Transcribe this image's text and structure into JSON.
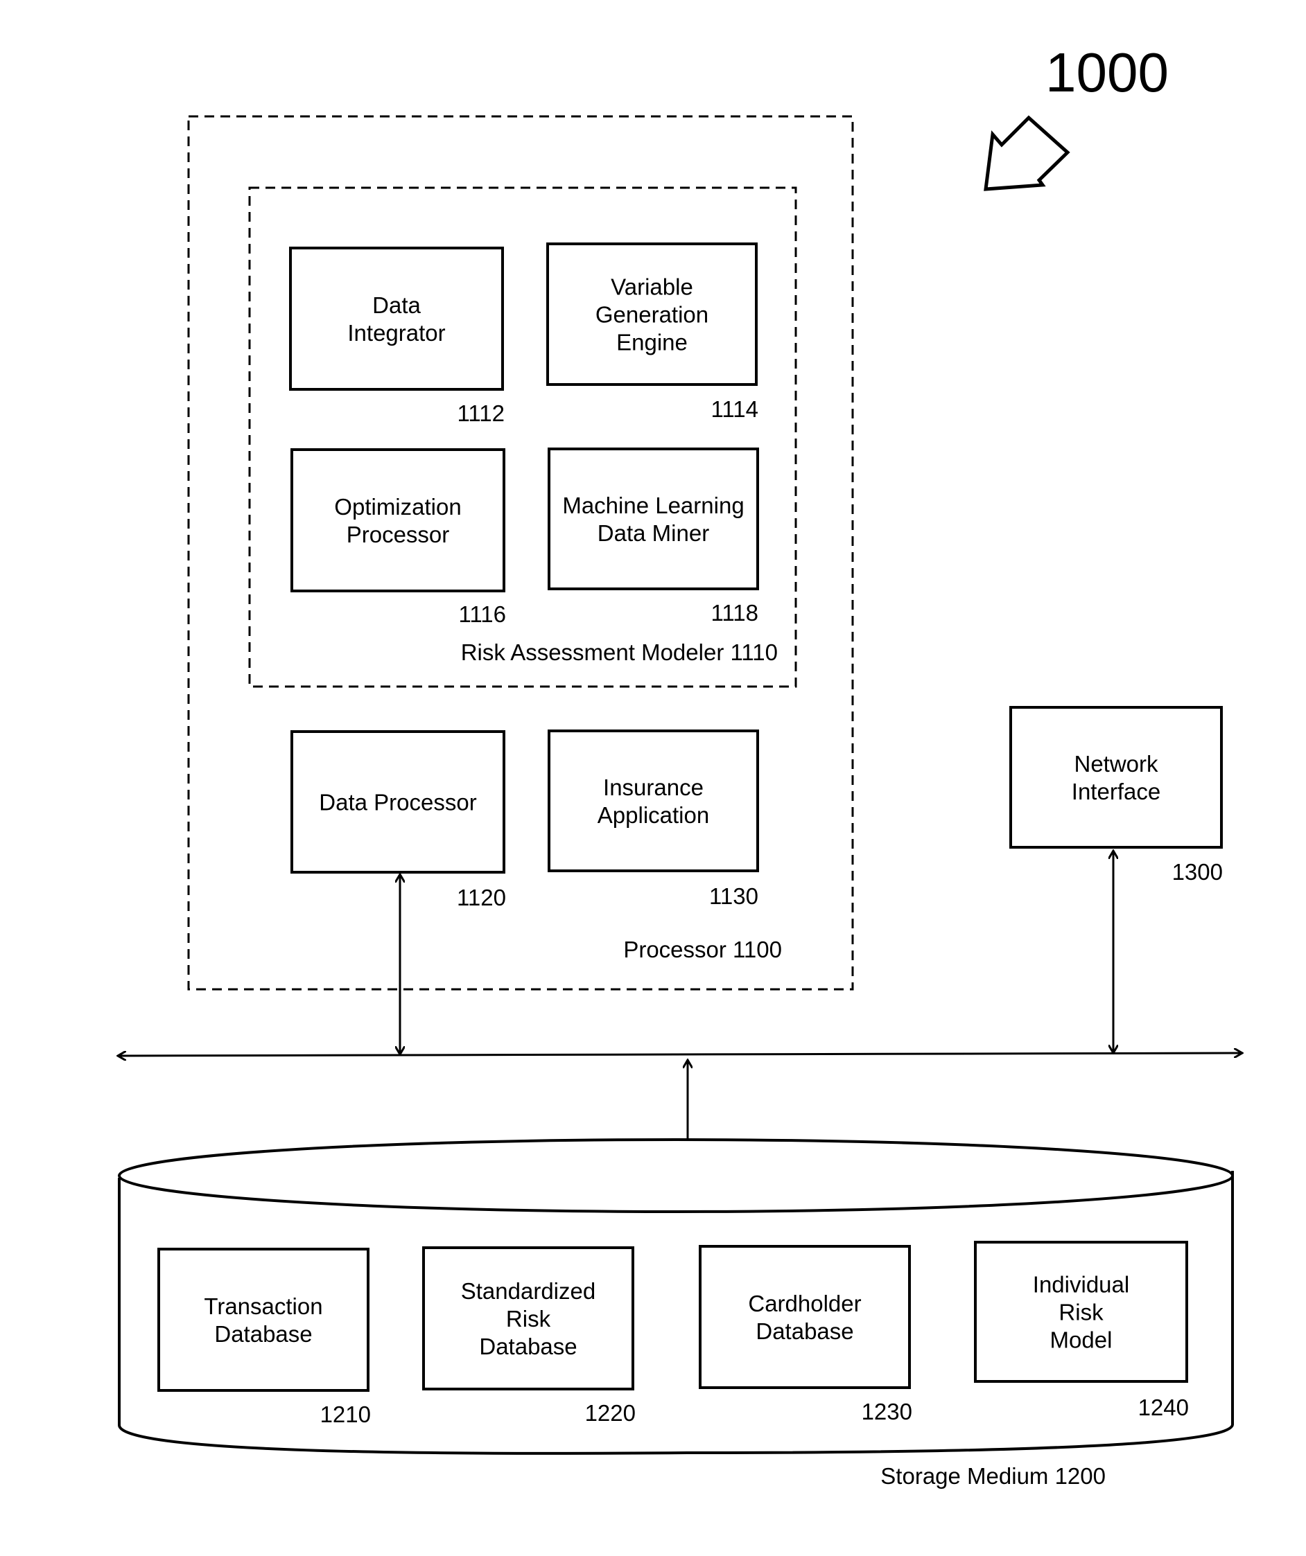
{
  "figure_number": "1000",
  "processor": {
    "label": "Processor 1100",
    "modeler": {
      "label": "Risk Assessment Modeler 1110",
      "components": [
        {
          "lines": [
            "Data",
            "Integrator"
          ],
          "ref": "1112"
        },
        {
          "lines": [
            "Variable",
            "Generation",
            "Engine"
          ],
          "ref": "1114"
        },
        {
          "lines": [
            "Optimization",
            "Processor"
          ],
          "ref": "1116"
        },
        {
          "lines": [
            "Machine Learning",
            "Data Miner"
          ],
          "ref": "1118"
        }
      ]
    },
    "components": [
      {
        "lines": [
          "Data Processor"
        ],
        "ref": "1120"
      },
      {
        "lines": [
          "Insurance",
          "Application"
        ],
        "ref": "1130"
      }
    ]
  },
  "network_interface": {
    "lines": [
      "Network",
      "Interface"
    ],
    "ref": "1300"
  },
  "storage": {
    "label": "Storage Medium 1200",
    "components": [
      {
        "lines": [
          "Transaction",
          "Database"
        ],
        "ref": "1210"
      },
      {
        "lines": [
          "Standardized",
          "Risk",
          "Database"
        ],
        "ref": "1220"
      },
      {
        "lines": [
          "Cardholder",
          "Database"
        ],
        "ref": "1230"
      },
      {
        "lines": [
          "Individual",
          "Risk",
          "Model"
        ],
        "ref": "1240"
      }
    ]
  }
}
